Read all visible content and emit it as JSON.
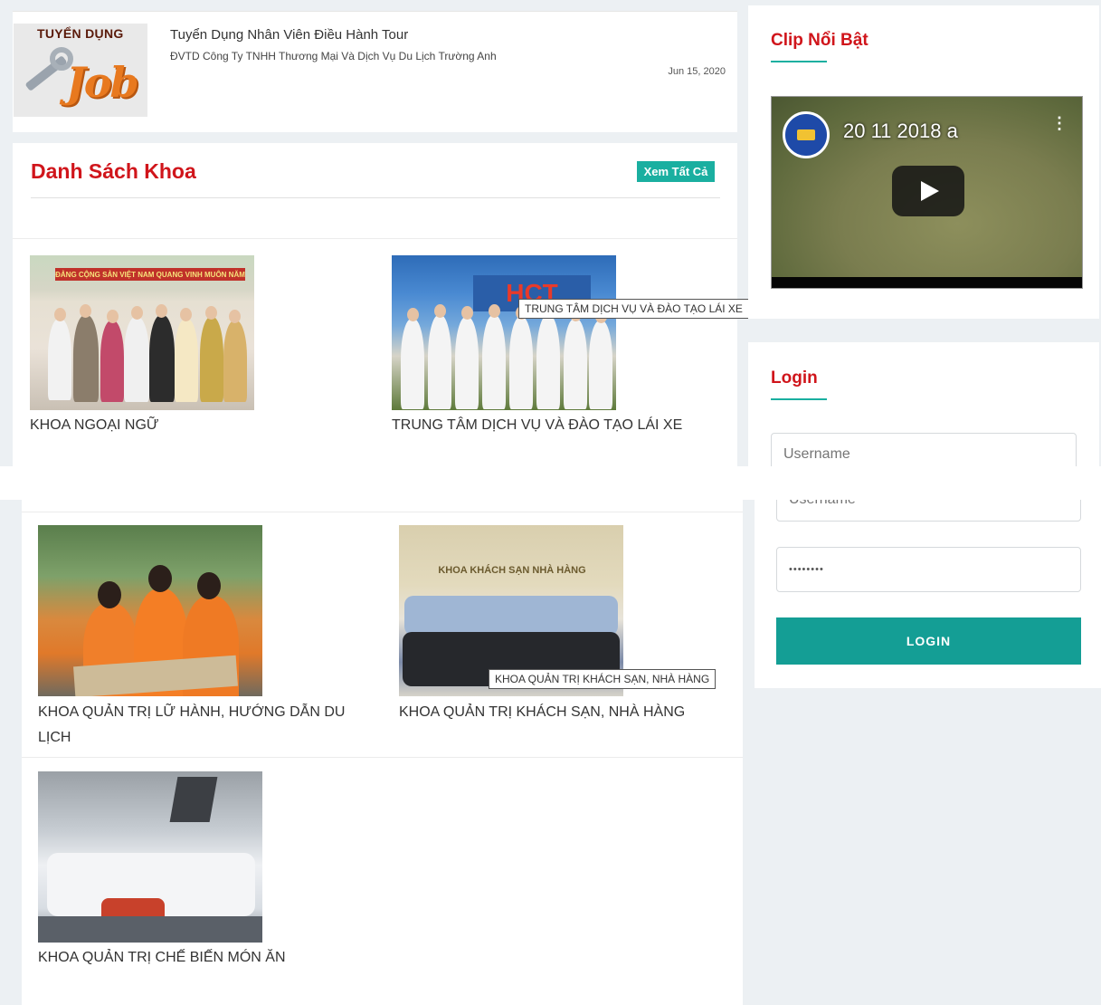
{
  "job": {
    "thumb_tag": "TUYỂN DỤNG",
    "thumb_word": "Job",
    "title": "Tuyển Dụng Nhân Viên Điều Hành Tour",
    "company": "ĐVTD Công Ty TNHH Thương Mại Và Dịch Vụ Du Lịch Trường Anh",
    "date": "Jun 15, 2020"
  },
  "departments": {
    "title": "Danh Sách Khoa",
    "see_all_label": "Xem Tất Cả",
    "items": [
      {
        "label": "KHOA NGOẠI NGỮ",
        "banner": "ĐẢNG CỘNG SẢN VIỆT NAM QUANG VINH MUÔN NĂM"
      },
      {
        "label": "TRUNG TÂM DỊCH VỤ VÀ ĐÀO TẠO LÁI XE",
        "tooltip": "TRUNG TÂM DỊCH VỤ VÀ ĐÀO TẠO LÁI XE",
        "banner": "HCT"
      },
      {
        "label_line1": "KHOA QUẢN TRỊ LỮ HÀNH, HƯỚNG DẪN DU",
        "label_line2": "LỊCH"
      },
      {
        "label": "KHOA QUẢN TRỊ KHÁCH SẠN, NHÀ HÀNG",
        "tooltip": "KHOA QUẢN TRỊ KHÁCH SẠN, NHÀ HÀNG",
        "banner": "KHOA KHÁCH SẠN NHÀ HÀNG"
      },
      {
        "label": "KHOA QUẢN TRỊ CHẾ BIẾN MÓN ĂN"
      }
    ]
  },
  "clip": {
    "title": "Clip Nổi Bật",
    "video_title": "20 11 2018 a",
    "menu_glyph": "⋮"
  },
  "login": {
    "title": "Login",
    "username_placeholder": "Username",
    "username_placeholder_clipped": "Username",
    "password_value": "••••••••",
    "button_label": "LOGIN"
  },
  "colors": {
    "accent_red": "#d0151b",
    "teal": "#1aafa0",
    "teal_dark": "#149e95",
    "background": "#ecf0f3"
  }
}
